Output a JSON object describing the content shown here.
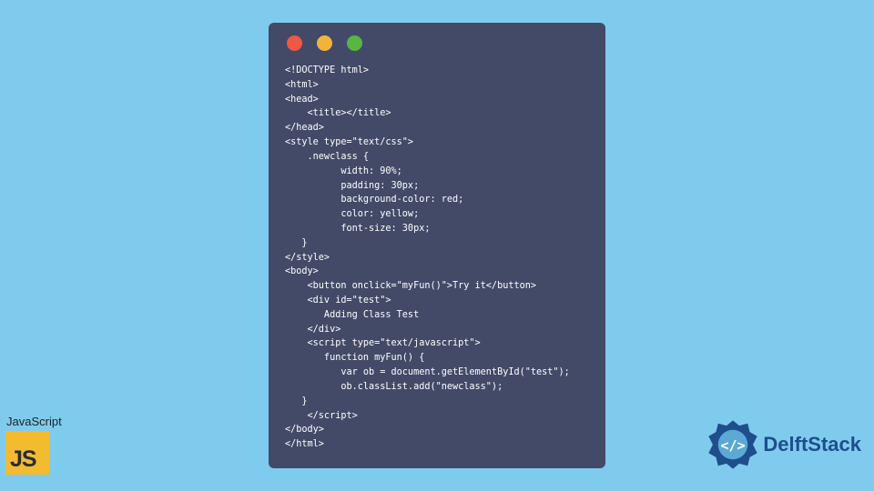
{
  "editor": {
    "traffic_lights": [
      "red",
      "yellow",
      "green"
    ],
    "code": "<!DOCTYPE html>\n<html>\n<head>\n    <title></title>\n</head>\n<style type=\"text/css\">\n    .newclass {\n          width: 90%;\n          padding: 30px;\n          background-color: red;\n          color: yellow;\n          font-size: 30px;\n   }\n</style>\n<body>\n    <button onclick=\"myFun()\">Try it</button>\n    <div id=\"test\">\n       Adding Class Test\n    </div>\n    <script type=\"text/javascript\">\n       function myFun() {\n          var ob = document.getElementById(\"test\");\n          ob.classList.add(\"newclass\");\n   }\n    </script>\n</body>\n</html>"
  },
  "js_badge": {
    "label": "JavaScript",
    "logo_text": "JS"
  },
  "delft_badge": {
    "text": "DelftStack"
  }
}
